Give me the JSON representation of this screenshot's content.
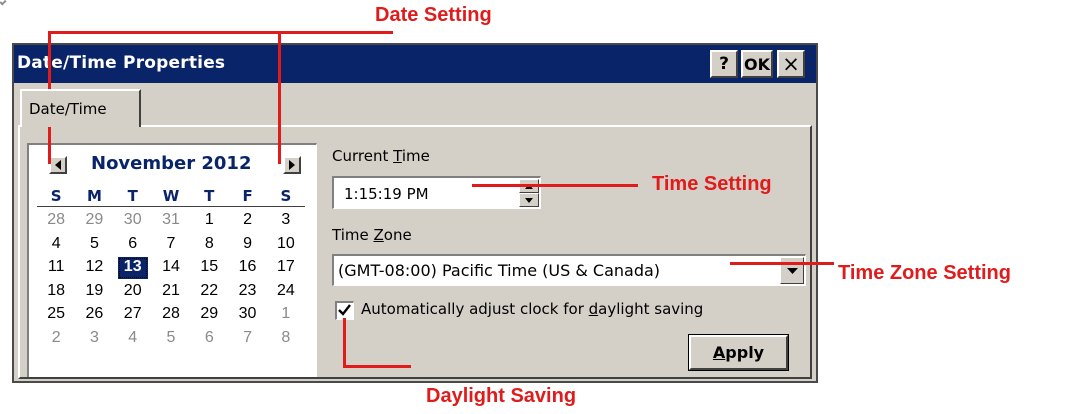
{
  "window": {
    "title": "Date/Time Properties",
    "help_label": "?",
    "ok_label": "OK",
    "close_label": "×"
  },
  "tabs": [
    {
      "label": "Date/Time"
    }
  ],
  "calendar": {
    "month_label": "November 2012",
    "weekdays": [
      "S",
      "M",
      "T",
      "W",
      "T",
      "F",
      "S"
    ],
    "days": [
      {
        "n": "28",
        "other": true
      },
      {
        "n": "29",
        "other": true
      },
      {
        "n": "30",
        "other": true
      },
      {
        "n": "31",
        "other": true
      },
      {
        "n": "1"
      },
      {
        "n": "2"
      },
      {
        "n": "3"
      },
      {
        "n": "4"
      },
      {
        "n": "5"
      },
      {
        "n": "6"
      },
      {
        "n": "7"
      },
      {
        "n": "8"
      },
      {
        "n": "9"
      },
      {
        "n": "10"
      },
      {
        "n": "11"
      },
      {
        "n": "12"
      },
      {
        "n": "13",
        "selected": true
      },
      {
        "n": "14"
      },
      {
        "n": "15"
      },
      {
        "n": "16"
      },
      {
        "n": "17"
      },
      {
        "n": "18"
      },
      {
        "n": "19"
      },
      {
        "n": "20"
      },
      {
        "n": "21"
      },
      {
        "n": "22"
      },
      {
        "n": "23"
      },
      {
        "n": "24"
      },
      {
        "n": "25"
      },
      {
        "n": "26"
      },
      {
        "n": "27"
      },
      {
        "n": "28"
      },
      {
        "n": "29"
      },
      {
        "n": "30"
      },
      {
        "n": "1",
        "other": true
      },
      {
        "n": "2",
        "other": true
      },
      {
        "n": "3",
        "other": true
      },
      {
        "n": "4",
        "other": true
      },
      {
        "n": "5",
        "other": true
      },
      {
        "n": "6",
        "other": true
      },
      {
        "n": "7",
        "other": true
      },
      {
        "n": "8",
        "other": true
      }
    ]
  },
  "current_time": {
    "label_before": "Current ",
    "label_accel": "T",
    "label_after": "ime",
    "value": "1:15:19 PM"
  },
  "time_zone": {
    "label_before": "Time ",
    "label_accel": "Z",
    "label_after": "one",
    "value": "(GMT-08:00) Pacific Time (US & Canada)"
  },
  "daylight": {
    "checked": true,
    "label_before": "Automatically adjust clock for ",
    "label_accel": "d",
    "label_after": "aylight saving"
  },
  "apply": {
    "label_accel": "A",
    "label_after": "pply"
  },
  "callouts": {
    "date_setting": "Date Setting",
    "time_setting": "Time Setting",
    "time_zone_setting": "Time Zone Setting",
    "daylight_saving": "Daylight Saving"
  },
  "colors": {
    "title_bar": "#0a246a",
    "callout_red": "#e01b1b",
    "dialog_face": "#d4d0c8"
  }
}
